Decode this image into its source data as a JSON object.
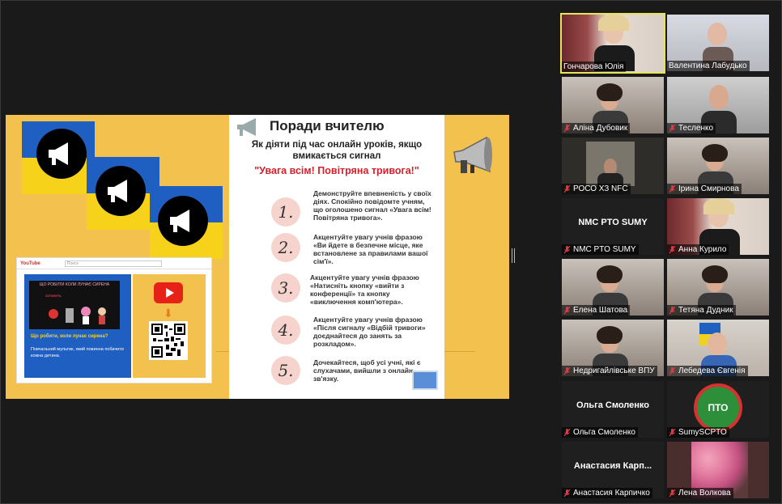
{
  "slide": {
    "poster_title": "Поради вчителю",
    "poster_subtitle": "Як діяти під час онлайн уроків, якщо вмикається сигнал",
    "poster_alert": "\"Увага всім! Повітряна тривога!\"",
    "tips": [
      {
        "num": "1.",
        "text": "Демонструйте впевненість у своїх діях. Спокійно повідомте учням, що оголошено сигнал «Увага всім! Повітряна тривога»."
      },
      {
        "num": "2.",
        "text": "Акцентуйте увагу учнів фразою «Ви йдете в безпечне місце, яке встановлене за правилами вашої сім'ї»."
      },
      {
        "num": "3.",
        "text": "Акцентуйте увагу учнів фразою «Натисніть кнопку «вийти з конференції» та кнопку «виключення комп'ютера»."
      },
      {
        "num": "4.",
        "text": "Акцентуйте увагу учнів фразою «Після сигналу «Відбій тривоги» доєднайтеся до занять за розкладом»."
      },
      {
        "num": "5.",
        "text": "Дочекайтеся, щоб усі учні, які є слухачами, вийшли з онлайн зв'язку."
      }
    ],
    "browser": {
      "logo": "YouTube",
      "search_placeholder": "Поиск",
      "video_thumb_title": "ЩО РОБИТИ КОЛИ ЛУНАЄ СИРЕНА",
      "video_thumb_sub": "ЗУПИНІТЬ",
      "video_title": "Що робити, коли лунає сирена?",
      "video_desc": "Повчальний мультик, який повинна побачити кожна дитина."
    }
  },
  "participants": [
    {
      "name": "Гончарова Юлія",
      "active": true,
      "muted": false,
      "video": "woman-blonde"
    },
    {
      "name": "Валентина Лабудько",
      "active": false,
      "muted": false,
      "video": "elder-woman"
    },
    {
      "name": "Аліна Дубовик",
      "active": false,
      "muted": true,
      "video": "woman-dark"
    },
    {
      "name": "Тесленко",
      "active": false,
      "muted": true,
      "video": "man"
    },
    {
      "name": "РОСО ХЗ NFC",
      "active": false,
      "muted": true,
      "video": "dark-room"
    },
    {
      "name": "Ірина Смирнова",
      "active": false,
      "muted": true,
      "video": "woman-dark"
    },
    {
      "name": "NMC PTO SUMY",
      "active": false,
      "muted": true,
      "video": "",
      "big_name": "NMC PTO SUMY"
    },
    {
      "name": "Анна Курило",
      "active": false,
      "muted": true,
      "video": "woman-blonde"
    },
    {
      "name": "Елена Шатова",
      "active": false,
      "muted": true,
      "video": "woman-dark"
    },
    {
      "name": "Тетяна Дудник",
      "active": false,
      "muted": true,
      "video": "woman-dark"
    },
    {
      "name": "Недригайлівське ВПУ",
      "active": false,
      "muted": true,
      "video": "woman-dark"
    },
    {
      "name": "Лебедева Євгенія",
      "active": false,
      "muted": true,
      "video": "woman-flag"
    },
    {
      "name": "Ольга Смоленко",
      "active": false,
      "muted": true,
      "video": "",
      "big_name": "Ольга Смоленко"
    },
    {
      "name": "SumySCPTO",
      "active": false,
      "muted": true,
      "video": "logo"
    },
    {
      "name": "Анастасия Карпичко",
      "active": false,
      "muted": true,
      "video": "",
      "big_name": "Анастасия  Карп..."
    },
    {
      "name": "Лена Волкова",
      "active": false,
      "muted": true,
      "video": "flowers"
    }
  ],
  "colors": {
    "muted_mic": "#e0383e",
    "active_border": "#e6e45a",
    "slide_bg": "#f3c14e"
  }
}
